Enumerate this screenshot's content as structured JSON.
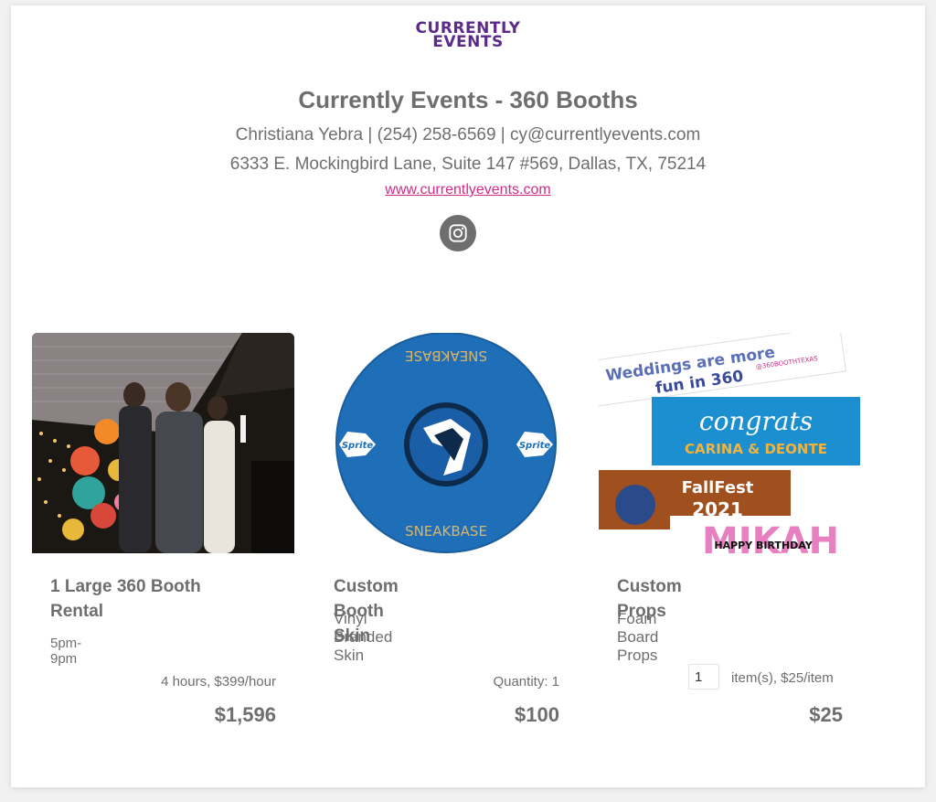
{
  "header": {
    "logo_line1": "CURRENTLY",
    "logo_line2": "EVENTS",
    "title": "Currently Events - 360 Booths",
    "contact": "Christiana Yebra | (254) 258-6569 | cy@currentlyevents.com",
    "address": "6333 E. Mockingbird Lane, Suite 147 #569, Dallas, TX, 75214",
    "website": "www.currentlyevents.com",
    "social_icon": "instagram-icon"
  },
  "items": [
    {
      "name_line1": "1 Large 360 Booth",
      "name_line2": "Rental",
      "time": "5pm-9pm",
      "calc": "4 hours, $399/hour",
      "price": "$1,596",
      "image": "event-photo"
    },
    {
      "name": "Custom Booth Skin",
      "description": "Vinyl Branded Skin",
      "calc": "Quantity: 1",
      "price": "$100",
      "image": "booth-skin-logo",
      "skin_text_top": "SNEAKBASE",
      "skin_text_bottom": "SNEAKBASE",
      "sponsor_left": "Sprite",
      "sponsor_right": "Sprite"
    },
    {
      "name": "Custom Props",
      "description": "Foam Board Props",
      "qty_value": "1",
      "calc": "item(s), $25/item",
      "price": "$25",
      "image": "foam-props",
      "prop1_line1": "Weddings are more",
      "prop1_line2": "fun in 360",
      "prop1_tag": "@360BOOTHTEXAS",
      "prop2_line1": "congrats",
      "prop2_line2": "CARINA & DEONTE",
      "prop3_line1": "FallFest",
      "prop3_line2": "2021",
      "prop4_line1": "MIKAH",
      "prop4_line2": "HAPPY BIRTHDAY"
    }
  ],
  "colors": {
    "brand": "#5b2a8a",
    "link": "#d12a8b",
    "text": "#6e6e6e"
  }
}
